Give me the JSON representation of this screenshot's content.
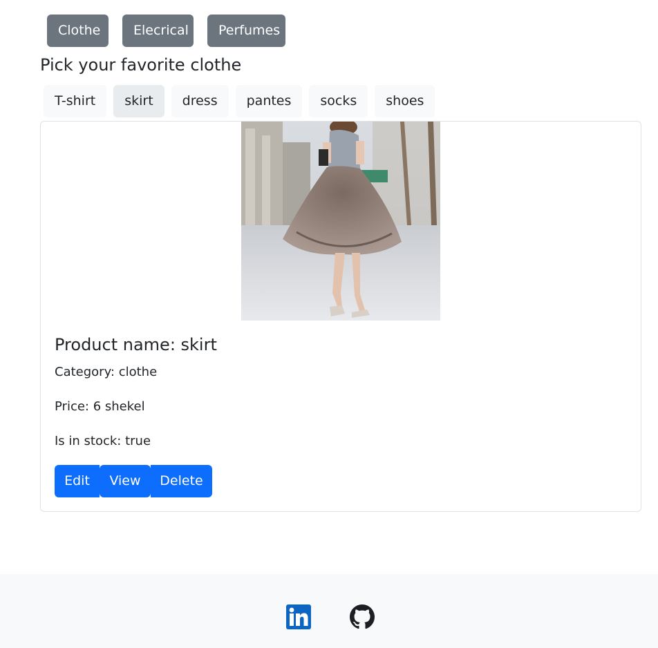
{
  "categories": {
    "buttons": [
      "Clothe",
      "Elecrical",
      "Perfumes"
    ]
  },
  "heading": "Pick your favorite clothe",
  "subcategories": {
    "tabs": [
      "T-shirt",
      "skirt",
      "dress",
      "pantes",
      "socks",
      "shoes"
    ],
    "selected": "skirt"
  },
  "product": {
    "name_line": "Product name: skirt",
    "category_line": "Category: clothe",
    "price_line": "Price: 6 shekel",
    "stock_line": "Is in stock: true",
    "image_icon": "skirt-photo"
  },
  "actions": {
    "edit": "Edit",
    "view": "View",
    "delete": "Delete"
  },
  "footer": {
    "icons": [
      "linkedin-icon",
      "github-icon"
    ]
  },
  "colors": {
    "secondary": "#6c757d",
    "primary": "#0d6efd",
    "light": "#f8f9fa",
    "linkedin": "#0a66c2",
    "text": "#212529"
  }
}
